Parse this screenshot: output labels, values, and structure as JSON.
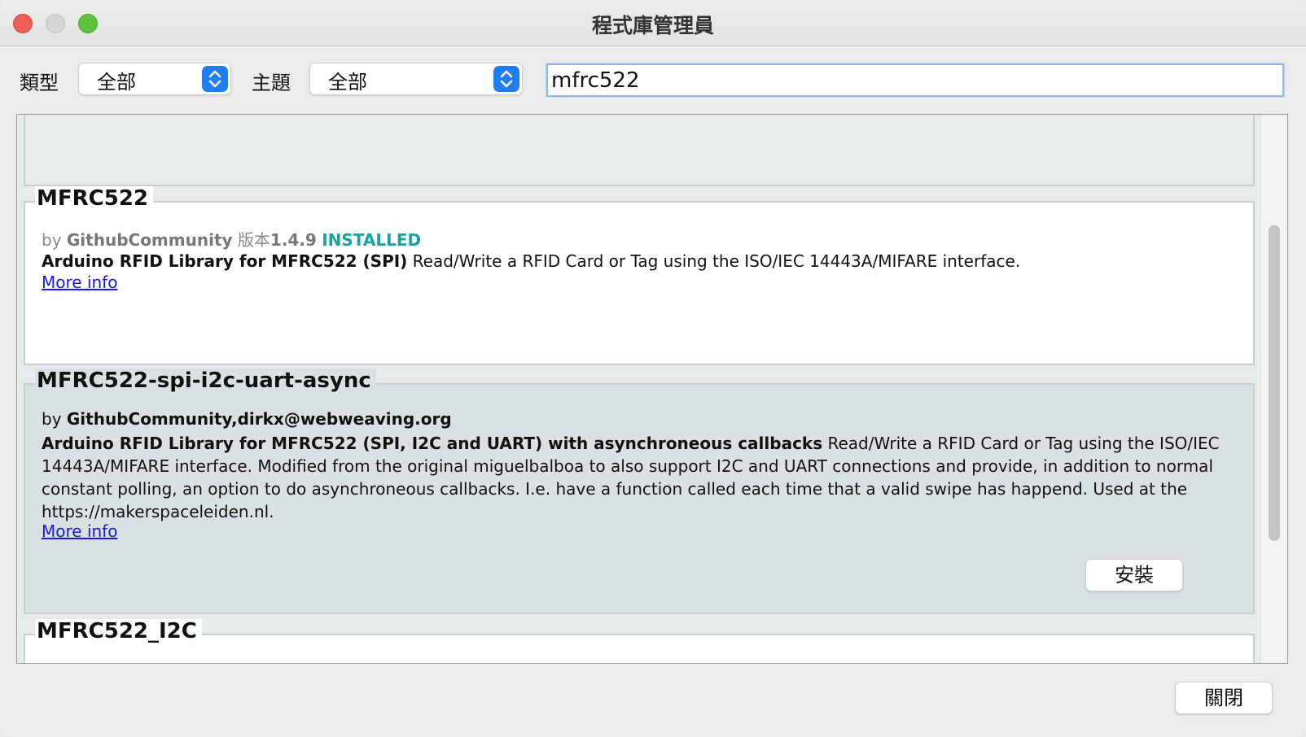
{
  "window": {
    "title": "程式庫管理員"
  },
  "filters": {
    "type_label": "類型",
    "type_value": "全部",
    "topic_label": "主題",
    "topic_value": "全部",
    "search_value": "mfrc522"
  },
  "libraries": [
    {
      "name": "MFRC522",
      "by_label": "by",
      "author": "GithubCommunity",
      "version_label": "版本",
      "version": "1.4.9",
      "status": "INSTALLED",
      "summary": "Arduino RFID Library for MFRC522 (SPI)",
      "description": "Read/Write a RFID Card or Tag using the ISO/IEC 14443A/MIFARE interface.",
      "more_info": "More info"
    },
    {
      "name": "MFRC522-spi-i2c-uart-async",
      "by_label": "by",
      "author": "GithubCommunity,dirkx@webweaving.org",
      "summary": "Arduino RFID Library for MFRC522 (SPI, I2C and UART) with asynchroneous callbacks",
      "description": "Read/Write a RFID Card or Tag using the ISO/IEC 14443A/MIFARE interface. Modified from the original miguelbalboa to also support I2C and UART connections and provide, in addition to normal constant polling, an option to do asynchroneous callbacks. I.e. have a function called each time that a valid swipe has happend. Used at the https://makerspaceleiden.nl.",
      "more_info": "More info",
      "install_label": "安裝"
    },
    {
      "name": "MFRC522_I2C"
    }
  ],
  "footer": {
    "close_label": "關閉"
  },
  "colors": {
    "accent": "#1f7ef5",
    "installed": "#1aa3a3",
    "link": "#1a1ae6"
  }
}
